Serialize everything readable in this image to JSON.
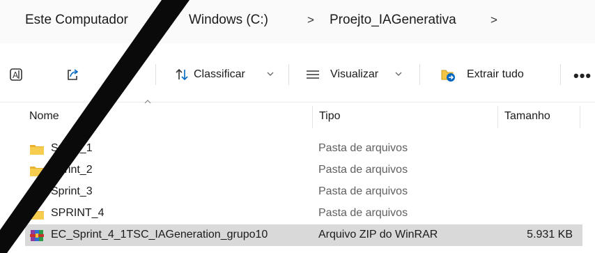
{
  "breadcrumb": {
    "items": [
      "Este Computador",
      "Windows (C:)",
      "Proejto_IAGenerativa"
    ],
    "separator": ">"
  },
  "toolbar": {
    "sort_label": "Classificar",
    "view_label": "Visualizar",
    "extract_label": "Extrair tudo",
    "more_label": "•••"
  },
  "columns": {
    "name": "Nome",
    "type": "Tipo",
    "size": "Tamanho"
  },
  "files": [
    {
      "name": "Sprint_1",
      "type": "Pasta de arquivos",
      "size": "",
      "icon": "folder-icon",
      "selected": false
    },
    {
      "name": "Sprint_2",
      "type": "Pasta de arquivos",
      "size": "",
      "icon": "folder-icon",
      "selected": false
    },
    {
      "name": "Sprint_3",
      "type": "Pasta de arquivos",
      "size": "",
      "icon": "folder-icon",
      "selected": false
    },
    {
      "name": "SPRINT_4",
      "type": "Pasta de arquivos",
      "size": "",
      "icon": "folder-icon",
      "selected": false
    },
    {
      "name": "EC_Sprint_4_1TSC_IAGeneration_grupo10",
      "type": "Arquivo ZIP do WinRAR",
      "size": "5.931 KB",
      "icon": "winrar-archive-icon",
      "selected": true
    }
  ],
  "colors": {
    "folder": "#f4c542",
    "accent": "#0067c0",
    "selection": "#d9d9d9"
  }
}
